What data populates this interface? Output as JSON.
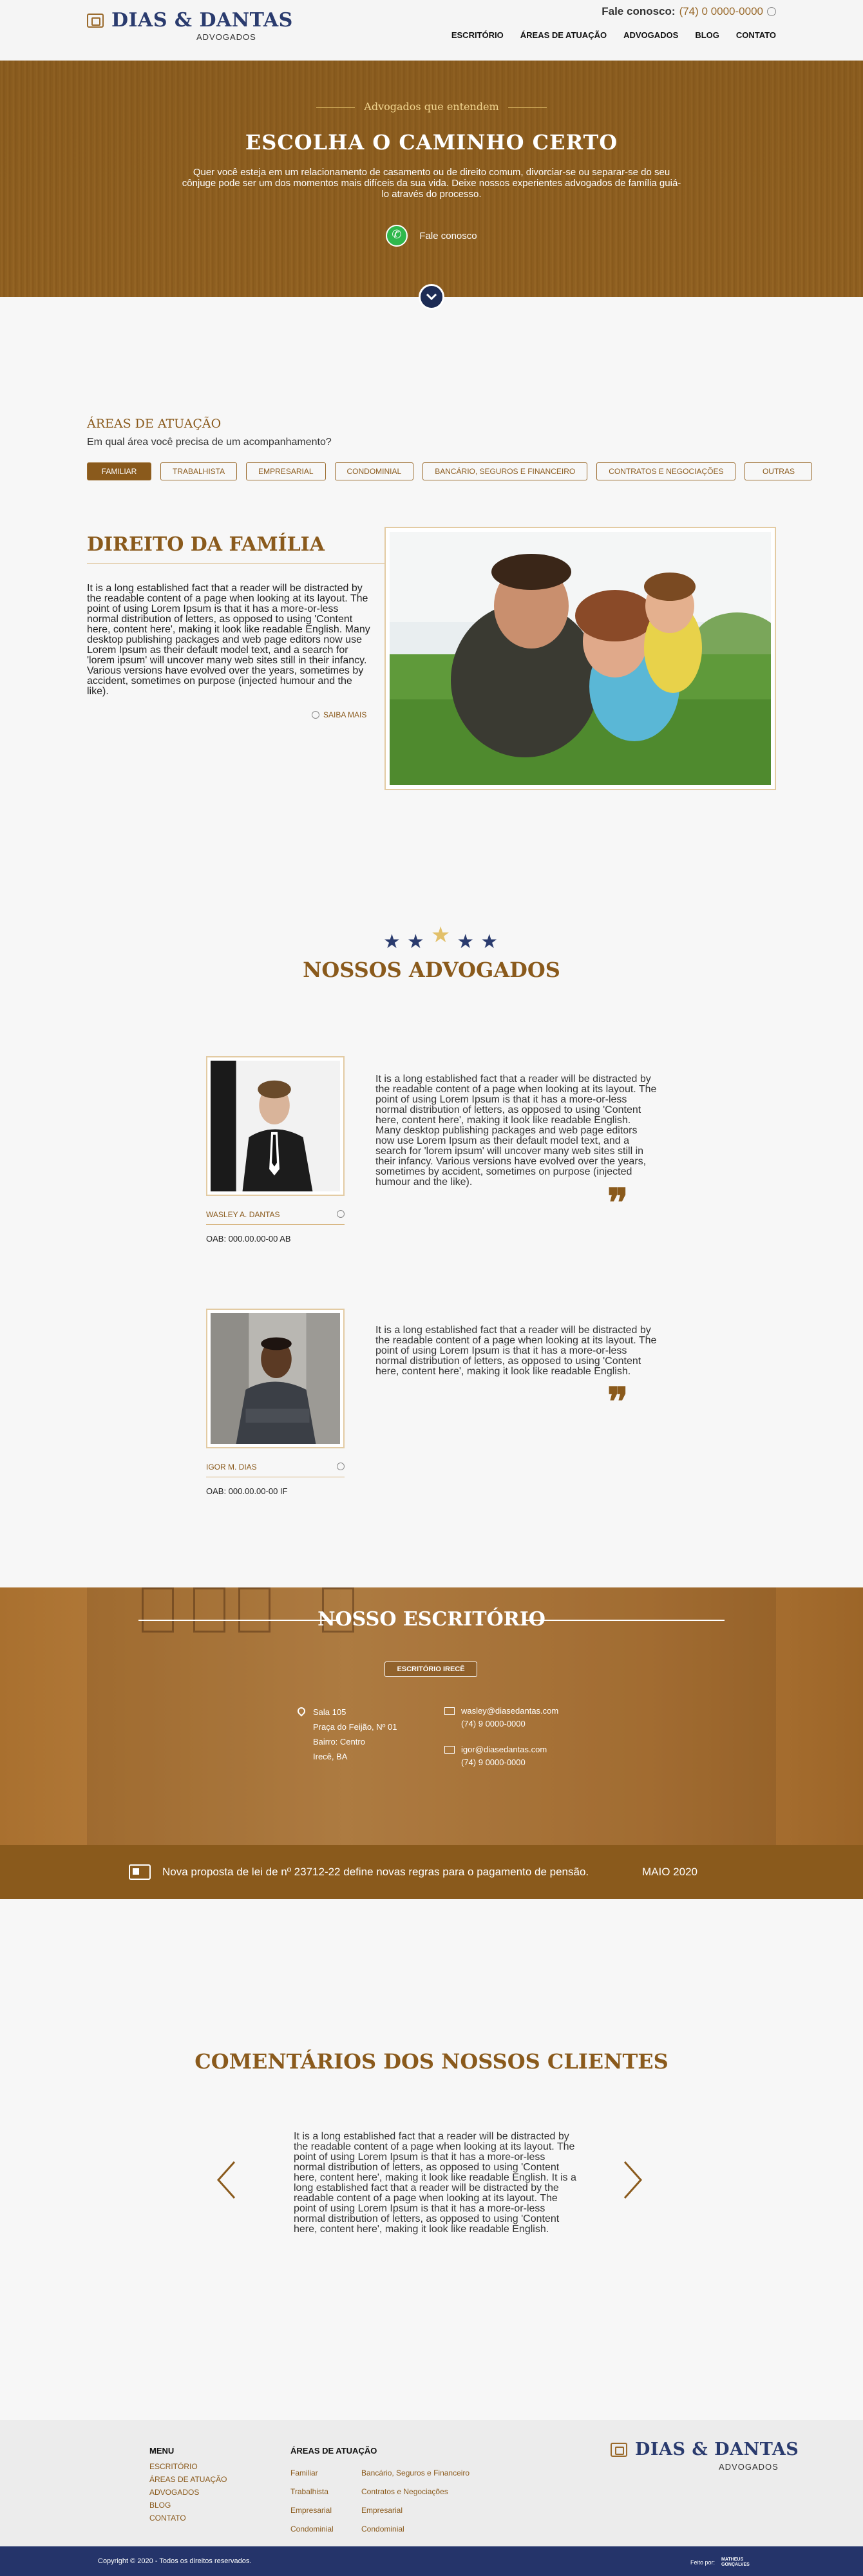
{
  "header": {
    "brand": "DIAS & DANTAS",
    "brand_sub": "ADVOGADOS",
    "phone_label": "Fale conosco:",
    "phone_number": "(74) 0 0000-0000",
    "nav": [
      "ESCRITÓRIO",
      "ÁREAS DE ATUAÇÃO",
      "ADVOGADOS",
      "BLOG",
      "CONTATO"
    ]
  },
  "hero": {
    "kicker": "Advogados que entendem",
    "title": "ESCOLHA O CAMINHO CERTO",
    "text": "Quer você esteja em um relacionamento de casamento ou de direito comum, divorciar-se ou separar-se do seu cônjuge pode ser um dos momentos mais difíceis da sua vida. Deixe nossos experientes advogados de família guiá-lo através do processo.",
    "cta": "Fale conosco"
  },
  "areas": {
    "label": "ÁREAS DE ATUAÇÃO",
    "question": "Em qual área você precisa de um acompanhamento?",
    "chips": [
      "FAMILIAR",
      "TRABALHISTA",
      "EMPRESARIAL",
      "CONDOMINIAL",
      "BANCÁRIO, SEGUROS E FINANCEIRO",
      "CONTRATOS E NEGOCIAÇÕES",
      "OUTRAS"
    ],
    "title": "DIREITO DA FAMÍLIA",
    "text": "It is a long established fact that a reader will be distracted by the readable content of a page when looking at its layout. The point of using Lorem Ipsum is that it has a more-or-less normal distribution of letters, as opposed to using 'Content here, content here', making it look like readable English. Many desktop publishing packages and web page editors now use Lorem Ipsum as their default model text, and a search for 'lorem ipsum' will uncover many web sites still in their infancy. Various versions have evolved over the years, sometimes by accident, sometimes on purpose (injected humour and the like).",
    "more": "SAIBA MAIS"
  },
  "advogados": {
    "title": "NOSSOS ADVOGADOS",
    "lawyers": [
      {
        "name": "WASLEY A. DANTAS",
        "oab": "OAB: 000.00.00-00 AB",
        "text": "It is a long established fact that a reader will be distracted by the readable content of a page when looking at its layout. The point of using Lorem Ipsum is that it has a more-or-less normal distribution of letters, as opposed to using 'Content here, content here', making it look like readable English. Many desktop publishing packages and web page editors now use Lorem Ipsum as their default model text, and a search for 'lorem ipsum' will uncover many web sites still in their infancy. Various versions have evolved over the years, sometimes by accident, sometimes on purpose (injected humour and the like)."
      },
      {
        "name": "IGOR M. DIAS",
        "oab": "OAB: 000.00.00-00 IF",
        "text": "It is a long established fact that a reader will be distracted by the readable content of a page when looking at its layout. The point of using Lorem Ipsum is that it has a more-or-less normal distribution of letters, as opposed to using 'Content here, content here', making it look like readable English."
      }
    ]
  },
  "escritorio": {
    "title": "NOSSO ESCRITÓRIO",
    "button": "ESCRITÓRIO IRECÊ",
    "address": [
      "Sala 105",
      "Praça do Feijão, Nº 01",
      "Bairro: Centro",
      "Irecê, BA"
    ],
    "contacts": [
      {
        "email": "wasley@diasedantas.com",
        "phone": "(74) 9 0000-0000"
      },
      {
        "email": "igor@diasedantas.com",
        "phone": "(74) 9 0000-0000"
      }
    ]
  },
  "news": {
    "text": "Nova proposta de lei de nº 23712-22 define novas regras para o pagamento de pensão.",
    "date": "MAIO 2020"
  },
  "comentarios": {
    "title": "COMENTÁRIOS DOS NOSSOS CLIENTES",
    "text": "It is a long established fact that a reader will be distracted by the readable content of a page when looking at its layout. The point of using Lorem Ipsum is that it has a more-or-less normal distribution of letters, as opposed to using 'Content here, content here', making it look like readable English. It is a long established fact that a reader will be distracted by the readable content of a page when looking at its layout. The point of using Lorem Ipsum is that it has a more-or-less normal distribution of letters, as opposed to using 'Content here, content here', making it look like readable English."
  },
  "footer": {
    "menu_title": "MENU",
    "menu": [
      "ESCRITÓRIO",
      "ÁREAS DE ATUAÇÃO",
      "ADVOGADOS",
      "BLOG",
      "CONTATO"
    ],
    "areas_title": "ÁREAS DE ATUAÇÃO",
    "areas_col1": [
      "Familiar",
      "Trabalhista",
      "Empresarial",
      "Condominial"
    ],
    "areas_col2": [
      "Bancário, Seguros e Financeiro",
      "Contratos e Negociações",
      "Empresarial",
      "Condominial"
    ],
    "brand": "DIAS & DANTAS",
    "brand_sub": "ADVOGADOS",
    "copyright": "Copyright © 2020 - Todos os direitos reservados.",
    "credit_label": "Feito por:",
    "credit_brand_1": "MATHEUS",
    "credit_brand_2": "GONÇALVES"
  },
  "colors": {
    "brand_brown": "#8a5a1c",
    "brand_navy": "#25346a",
    "whatsapp_green": "#2fb84c"
  }
}
